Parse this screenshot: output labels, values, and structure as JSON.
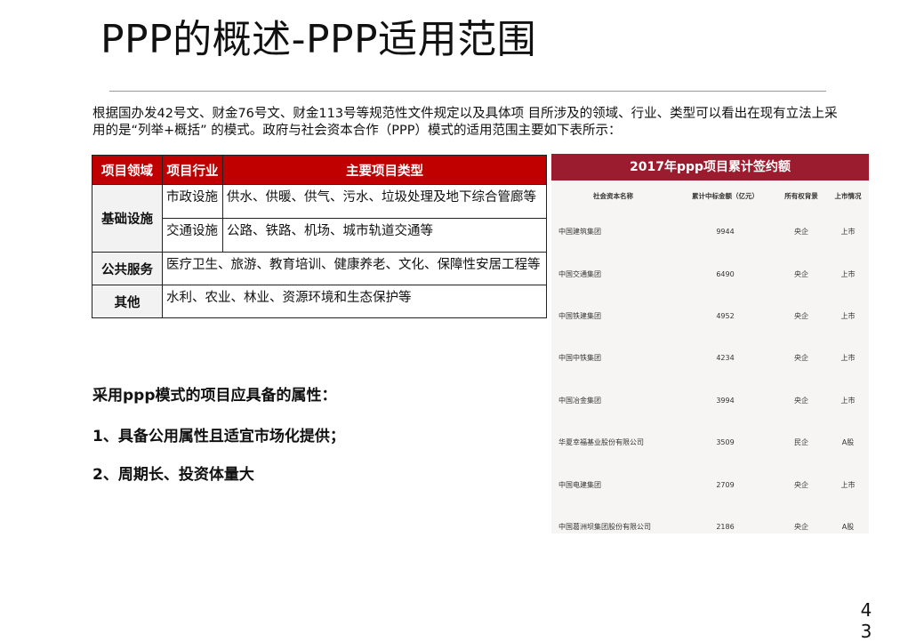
{
  "slide": {
    "title": "PPP的概述-PPP适用范围",
    "intro": "根据国办发42号文、财金76号文、财金113号等规范性文件规定以及具体项 目所涉及的领域、行业、类型可以看出在现有立法上采用的是“列举+概括” 的模式。政府与社会资本合作（PPP）模式的适用范围主要如下表所示：",
    "page_number_top": "4",
    "page_number_bottom": "3"
  },
  "scope_table": {
    "headers": [
      "项目领域",
      "项目行业",
      "主要项目类型"
    ],
    "rows": [
      {
        "domain": "基础设施",
        "industry": "市政设施",
        "types": "供水、供暖、供气、污水、垃圾处理及地下综合管廊等"
      },
      {
        "domain": "",
        "industry": "交通设施",
        "types": "公路、铁路、机场、城市轨道交通等"
      },
      {
        "domain": "公共服务",
        "industry": "",
        "types": "医疗卫生、旅游、教育培训、健康养老、文化、保障性安居工程等"
      },
      {
        "domain": "其他",
        "industry": "",
        "types": "水利、农业、林业、资源环境和生态保护等"
      }
    ]
  },
  "attributes": {
    "heading": "采用ppp模式的项目应具备的属性：",
    "items": [
      "1、具备公用属性且适宜市场化提供；",
      "2、周期长、投资体量大"
    ]
  },
  "contract_panel": {
    "title": "2017年ppp项目累计签约额",
    "title_bg": "#9b1c2e",
    "headers": [
      "社会资本名称",
      "累计中标金额（亿元）",
      "所有权背景",
      "上市情况"
    ],
    "rows": [
      [
        "中国建筑集团",
        "9944",
        "央企",
        "上市"
      ],
      [
        "中国交通集团",
        "6490",
        "央企",
        "上市"
      ],
      [
        "中国铁建集团",
        "4952",
        "央企",
        "上市"
      ],
      [
        "中国中铁集团",
        "4234",
        "央企",
        "上市"
      ],
      [
        "中国冶金集团",
        "3994",
        "央企",
        "上市"
      ],
      [
        "华夏幸福基业股份有限公司",
        "3509",
        "民企",
        "A股"
      ],
      [
        "中国电建集团",
        "2709",
        "央企",
        "上市"
      ],
      [
        "中国葛洲坝集团股份有限公司",
        "2186",
        "央企",
        "A股"
      ]
    ]
  },
  "colors": {
    "header_red": "#c00000",
    "panel_bg": "#f7f5f3"
  }
}
